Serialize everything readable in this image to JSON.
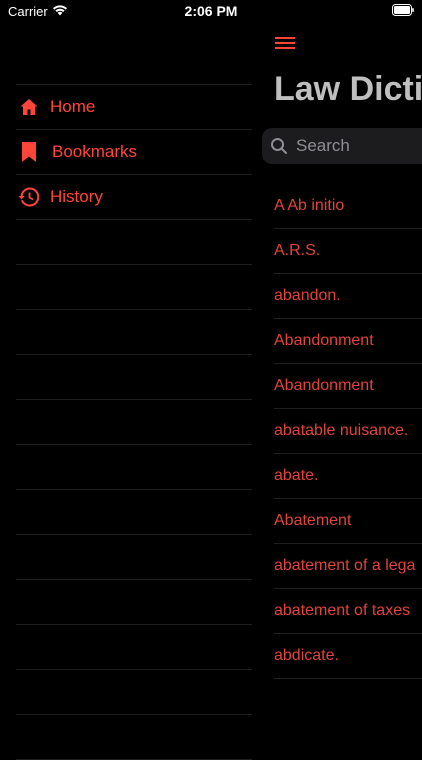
{
  "status_bar": {
    "carrier": "Carrier",
    "time": "2:06 PM"
  },
  "side_menu": {
    "items": [
      {
        "label": "Home",
        "icon": "home-icon"
      },
      {
        "label": "Bookmarks",
        "icon": "bookmark-icon"
      },
      {
        "label": "History",
        "icon": "history-icon"
      }
    ]
  },
  "main": {
    "title": "Law Dicti",
    "search": {
      "placeholder": "Search",
      "value": ""
    },
    "terms": [
      "A Ab initio",
      "A.R.S.",
      "abandon.",
      "Abandonment",
      "Abandonment",
      "abatable nuisance.",
      "abate.",
      "Abatement",
      "abatement of a lega",
      "abatement of taxes",
      "abdicate."
    ]
  },
  "colors": {
    "accent": "#ff453a",
    "background": "#000000",
    "separator": "#1f1f1f",
    "title": "#bfbfbf"
  }
}
